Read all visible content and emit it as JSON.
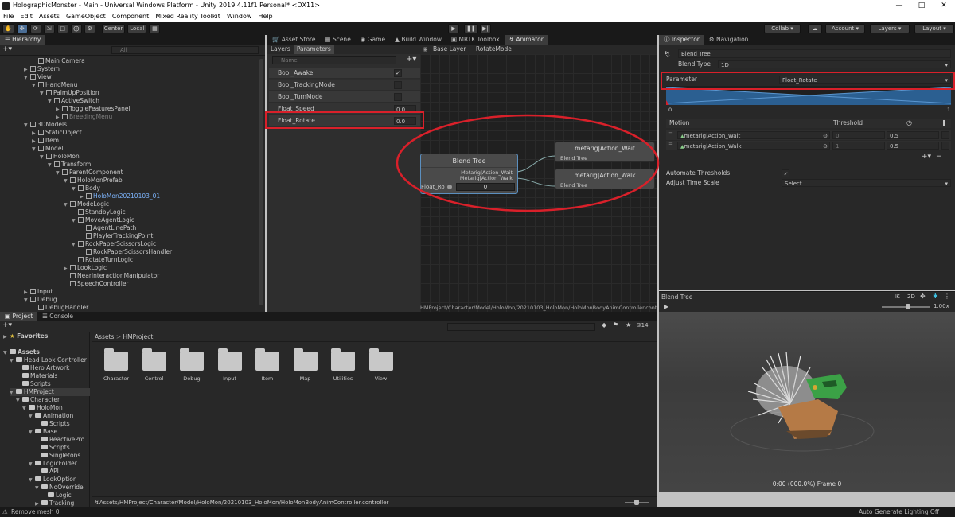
{
  "window": {
    "title": "HolographicMonster - Main - Universal Windows Platform - Unity 2019.4.11f1 Personal* <DX11>"
  },
  "menu": [
    "File",
    "Edit",
    "Assets",
    "GameObject",
    "Component",
    "Mixed Reality Toolkit",
    "Window",
    "Help"
  ],
  "toolbar": {
    "pivot": "Center",
    "space": "Local",
    "collab": "Collab",
    "account": "Account",
    "layers": "Layers",
    "layout": "Layout"
  },
  "hierarchy": {
    "tab": "Hierarchy",
    "search_placeholder": "All",
    "rows": [
      {
        "label": "Main Camera",
        "indent": 4,
        "arrow": ""
      },
      {
        "label": "System",
        "indent": 3,
        "arrow": "▶"
      },
      {
        "label": "View",
        "indent": 3,
        "arrow": "▼"
      },
      {
        "label": "HandMenu",
        "indent": 4,
        "arrow": "▼"
      },
      {
        "label": "PalmUpPosition",
        "indent": 5,
        "arrow": "▼"
      },
      {
        "label": "ActiveSwitch",
        "indent": 6,
        "arrow": "▼"
      },
      {
        "label": "ToggleFeaturesPanel",
        "indent": 7,
        "arrow": "▶"
      },
      {
        "label": "BreedingMenu",
        "indent": 7,
        "arrow": "▶"
      },
      {
        "label": "3DModels",
        "indent": 3,
        "arrow": "▼"
      },
      {
        "label": "StaticObject",
        "indent": 4,
        "arrow": "▶"
      },
      {
        "label": "Item",
        "indent": 4,
        "arrow": "▶"
      },
      {
        "label": "Model",
        "indent": 4,
        "arrow": "▼"
      },
      {
        "label": "HoloMon",
        "indent": 5,
        "arrow": "▼"
      },
      {
        "label": "Transform",
        "indent": 6,
        "arrow": "▼"
      },
      {
        "label": "ParentComponent",
        "indent": 7,
        "arrow": "▼"
      },
      {
        "label": "HoloMonPrefab",
        "indent": 8,
        "arrow": "▼"
      },
      {
        "label": "Body",
        "indent": 9,
        "arrow": "▼"
      },
      {
        "label": "HoloMon20210103_01",
        "indent": 10,
        "arrow": "▶"
      },
      {
        "label": "ModeLogic",
        "indent": 8,
        "arrow": "▼"
      },
      {
        "label": "StandbyLogic",
        "indent": 9,
        "arrow": ""
      },
      {
        "label": "MoveAgentLogic",
        "indent": 9,
        "arrow": "▼"
      },
      {
        "label": "AgentLinePath",
        "indent": 10,
        "arrow": ""
      },
      {
        "label": "PlaylerTrackingPoint",
        "indent": 10,
        "arrow": ""
      },
      {
        "label": "RockPaperScissorsLogic",
        "indent": 9,
        "arrow": "▼"
      },
      {
        "label": "RockPaperScissorsHandler",
        "indent": 10,
        "arrow": ""
      },
      {
        "label": "RotateTurnLogic",
        "indent": 9,
        "arrow": ""
      },
      {
        "label": "LookLogic",
        "indent": 8,
        "arrow": "▶"
      },
      {
        "label": "NearInteractionManipulator",
        "indent": 8,
        "arrow": ""
      },
      {
        "label": "SpeechController",
        "indent": 8,
        "arrow": ""
      },
      {
        "label": "Input",
        "indent": 3,
        "arrow": "▶"
      },
      {
        "label": "Debug",
        "indent": 3,
        "arrow": "▼"
      },
      {
        "label": "DebugHandler",
        "indent": 4,
        "arrow": ""
      }
    ]
  },
  "center_tabs": [
    "Asset Store",
    "Scene",
    "Game",
    "Build Window",
    "MRTK Toolbox",
    "Animator"
  ],
  "animator": {
    "subtabs": [
      "Layers",
      "Parameters"
    ],
    "search_placeholder": "Name",
    "breadcrumb": [
      "Base Layer",
      "RotateMode"
    ],
    "parameters": [
      {
        "name": "Bool_Awake",
        "type": "bool",
        "value": "✓"
      },
      {
        "name": "Bool_TrackingMode",
        "type": "bool",
        "value": ""
      },
      {
        "name": "Bool_TurnMode",
        "type": "bool",
        "value": ""
      },
      {
        "name": "Float_Speed",
        "type": "float",
        "value": "0.0"
      },
      {
        "name": "Float_Rotate",
        "type": "float",
        "value": "0.0"
      }
    ],
    "blend_node": {
      "title": "Blend Tree",
      "out1": "Metarig|Action_Wait",
      "out2": "Metarig|Action_Walk",
      "param": "Float_Ro",
      "value": "0"
    },
    "motion_nodes": [
      {
        "title": "metarig|Action_Wait",
        "sub": "Blend Tree"
      },
      {
        "title": "metarig|Action_Walk",
        "sub": "Blend Tree"
      }
    ],
    "path": "HMProject/Character/Model/HoloMon/20210103_HoloMon/HoloMonBodyAnimController.controller"
  },
  "inspector": {
    "tabs": [
      "Inspector",
      "Navigation"
    ],
    "object_name": "Blend Tree",
    "blend_type_label": "Blend Type",
    "blend_type_value": "1D",
    "parameter_label": "Parameter",
    "parameter_value": "Float_Rotate",
    "axis_min": "0",
    "axis_max": "1",
    "motion_header": "Motion",
    "threshold_header": "Threshold",
    "motions": [
      {
        "name": "metarig|Action_Wait",
        "threshold": "0",
        "speed": "0.5"
      },
      {
        "name": "metarig|Action_Walk",
        "threshold": "1",
        "speed": "0.5"
      }
    ],
    "automate_label": "Automate Thresholds",
    "automate_value": "✓",
    "adjust_label": "Adjust Time Scale",
    "adjust_value": "Select",
    "preview_title": "Blend Tree",
    "preview_ik": "IK",
    "preview_2d": "2D",
    "preview_speed": "1.00x",
    "preview_time": "0:00 (000.0%) Frame 0"
  },
  "project": {
    "tabs": [
      "Project",
      "Console"
    ],
    "favorites": "Favorites",
    "hidden_count": "14",
    "tree": [
      {
        "label": "Assets",
        "indent": 0,
        "arrow": "▼",
        "bold": true
      },
      {
        "label": "Head Look Controller",
        "indent": 1,
        "arrow": "▼"
      },
      {
        "label": "Hero Artwork",
        "indent": 2,
        "arrow": ""
      },
      {
        "label": "Materials",
        "indent": 2,
        "arrow": ""
      },
      {
        "label": "Scripts",
        "indent": 2,
        "arrow": ""
      },
      {
        "label": "HMProject",
        "indent": 1,
        "arrow": "▼"
      },
      {
        "label": "Character",
        "indent": 2,
        "arrow": "▼"
      },
      {
        "label": "HoloMon",
        "indent": 3,
        "arrow": "▼"
      },
      {
        "label": "Animation",
        "indent": 4,
        "arrow": "▼"
      },
      {
        "label": "Scripts",
        "indent": 5,
        "arrow": ""
      },
      {
        "label": "Base",
        "indent": 4,
        "arrow": "▼"
      },
      {
        "label": "ReactivePro",
        "indent": 5,
        "arrow": ""
      },
      {
        "label": "Scripts",
        "indent": 5,
        "arrow": ""
      },
      {
        "label": "Singletons",
        "indent": 5,
        "arrow": ""
      },
      {
        "label": "LogicFolder",
        "indent": 4,
        "arrow": "▼"
      },
      {
        "label": "API",
        "indent": 5,
        "arrow": ""
      },
      {
        "label": "LookOption",
        "indent": 4,
        "arrow": "▼"
      },
      {
        "label": "NoOverride",
        "indent": 5,
        "arrow": "▼"
      },
      {
        "label": "Logic",
        "indent": 6,
        "arrow": ""
      },
      {
        "label": "Tracking",
        "indent": 5,
        "arrow": "▶"
      }
    ],
    "breadcrumb": [
      "Assets",
      "HMProject"
    ],
    "folders": [
      "Character",
      "Control",
      "Debug",
      "Input",
      "Item",
      "Map",
      "Utilities",
      "View"
    ],
    "footer_path": "Assets/HMProject/Character/Model/HoloMon/20210103_HoloMon/HoloMonBodyAnimController.controller"
  },
  "status": {
    "left": "Remove mesh 0",
    "right": "Auto Generate Lighting Off"
  },
  "colors": {
    "highlight": "#d9202a",
    "selection": "#2c5d87",
    "accent_blue": "#3a76b3"
  }
}
